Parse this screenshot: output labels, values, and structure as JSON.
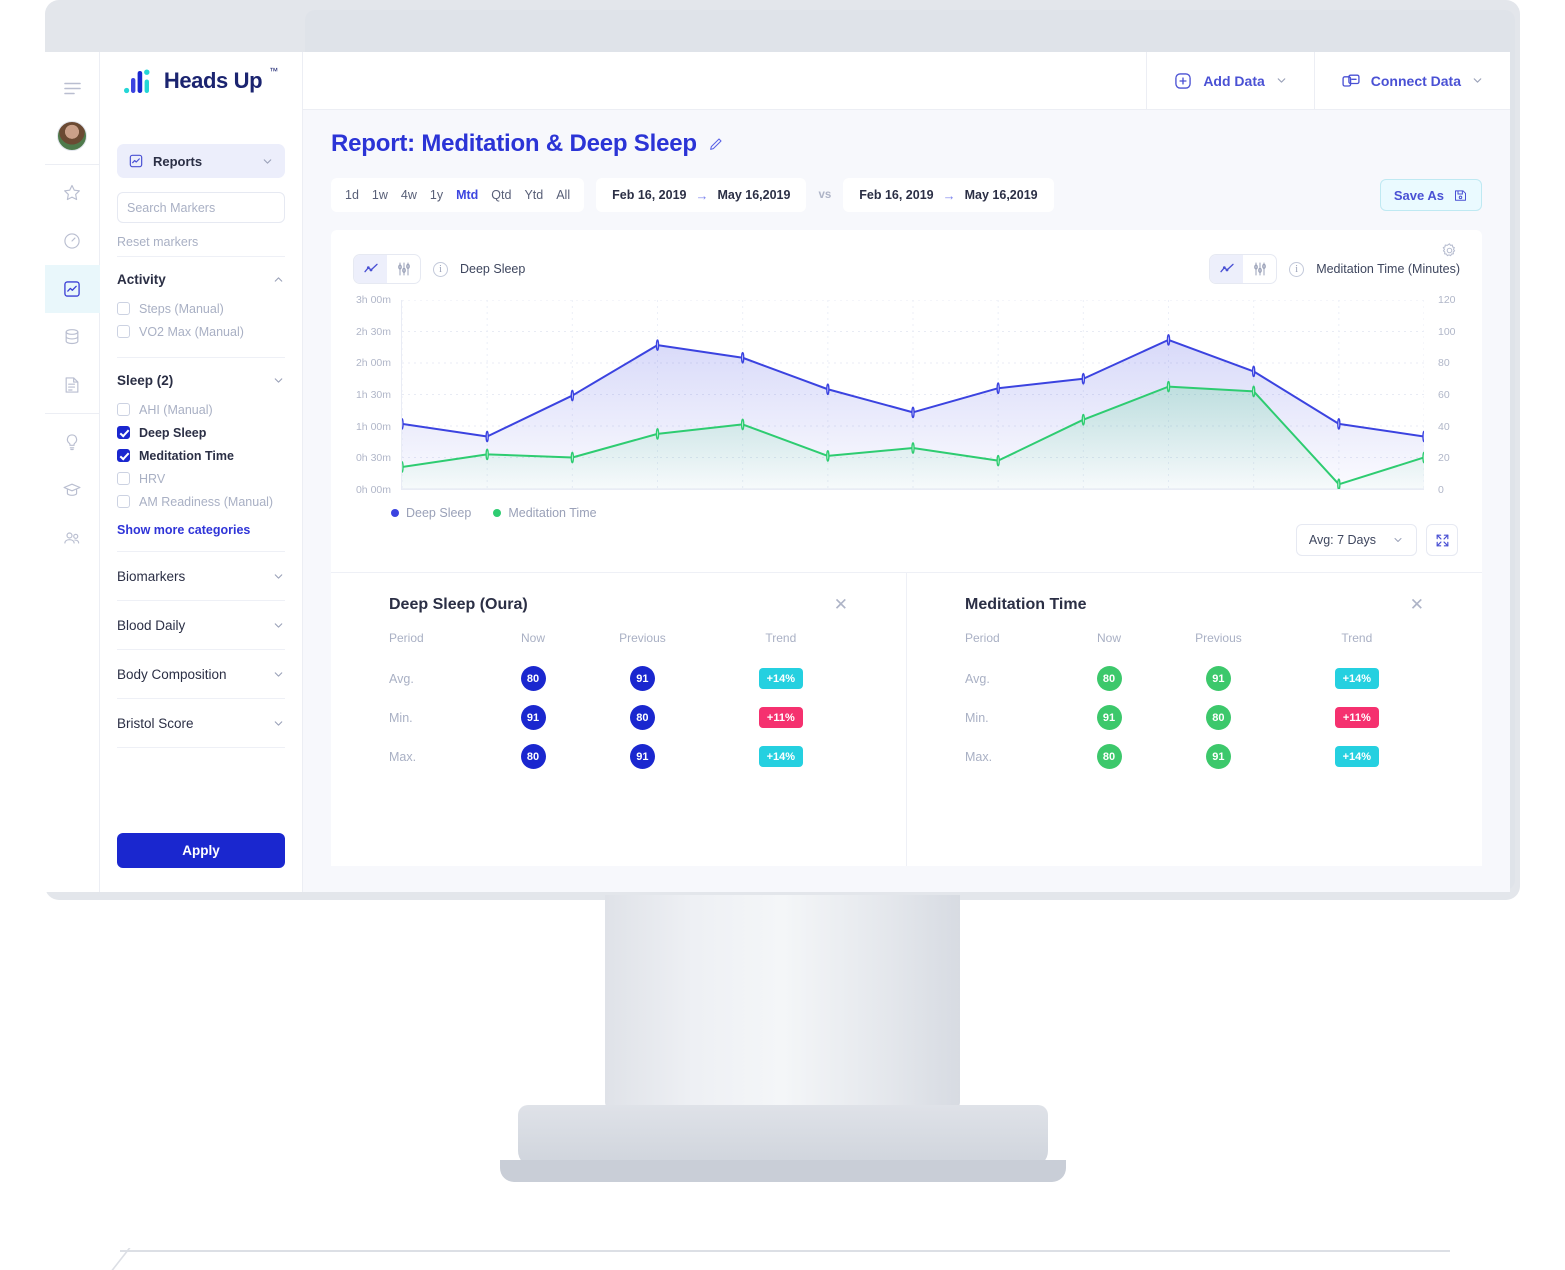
{
  "brand": {
    "name": "Heads Up",
    "tm": "™"
  },
  "rail": {
    "items": [
      {
        "name": "menu-icon",
        "label": "Menu"
      },
      {
        "name": "avatar",
        "label": "User avatar"
      },
      {
        "name": "star-icon",
        "label": "Favorites"
      },
      {
        "name": "gauge-icon",
        "label": "Dashboard"
      },
      {
        "name": "chart-icon",
        "label": "Reports"
      },
      {
        "name": "database-icon",
        "label": "Data"
      },
      {
        "name": "document-icon",
        "label": "Notes"
      },
      {
        "name": "lightbulb-icon",
        "label": "Insights"
      },
      {
        "name": "graduation-cap-icon",
        "label": "Learn"
      },
      {
        "name": "people-icon",
        "label": "Community"
      }
    ]
  },
  "sidebar": {
    "reports_label": "Reports",
    "search_placeholder": "Search Markers",
    "search_value": "",
    "reset_label": "Reset markers",
    "show_more_label": "Show more categories",
    "apply_label": "Apply",
    "groups": [
      {
        "title": "Activity",
        "expanded": true,
        "markers": [
          {
            "label": "Steps (Manual)",
            "checked": false
          },
          {
            "label": "VO2 Max (Manual)",
            "checked": false
          }
        ]
      },
      {
        "title": "Sleep (2)",
        "expanded": true,
        "markers": [
          {
            "label": "AHI (Manual)",
            "checked": false
          },
          {
            "label": "Deep Sleep",
            "checked": true
          },
          {
            "label": "Meditation Time",
            "checked": true
          },
          {
            "label": "HRV",
            "checked": false
          },
          {
            "label": "AM Readiness (Manual)",
            "checked": false
          }
        ]
      }
    ],
    "collapsed_categories": [
      {
        "title": "Biomarkers"
      },
      {
        "title": "Blood Daily"
      },
      {
        "title": "Body Composition"
      },
      {
        "title": "Bristol Score"
      }
    ]
  },
  "topbar": {
    "add_data_label": "Add Data",
    "connect_data_label": "Connect Data"
  },
  "page": {
    "title": "Report: Meditation & Deep Sleep",
    "edit_icon": "pencil-icon",
    "ranges": [
      {
        "label": "1d",
        "active": false
      },
      {
        "label": "1w",
        "active": false
      },
      {
        "label": "4w",
        "active": false
      },
      {
        "label": "1y",
        "active": false
      },
      {
        "label": "Mtd",
        "active": true
      },
      {
        "label": "Qtd",
        "active": false
      },
      {
        "label": "Ytd",
        "active": false
      },
      {
        "label": "All",
        "active": false
      }
    ],
    "date_primary": {
      "from": "Feb 16, 2019",
      "to": "May 16,2019"
    },
    "vs_label": "vs",
    "date_compare": {
      "from": "Feb 16, 2019",
      "to": "May 16,2019"
    },
    "save_as_label": "Save As",
    "avg_select_label": "Avg: 7 Days"
  },
  "chart_header": {
    "left_series": "Deep Sleep",
    "right_series": "Meditation Time (Minutes)"
  },
  "chart_data": {
    "type": "line",
    "title": "",
    "xlabel": "",
    "grid": true,
    "legend_position": "bottom-left",
    "x": [
      1,
      2,
      3,
      4,
      5,
      6,
      7,
      8,
      9,
      10,
      11,
      12,
      13
    ],
    "y_left": {
      "label": "Deep Sleep",
      "ticks": [
        "0h 00m",
        "0h 30m",
        "1h 00m",
        "1h 30m",
        "2h 00m",
        "2h 30m",
        "3h 00m"
      ],
      "ylim": [
        0,
        180
      ],
      "unit": "minutes"
    },
    "y_right": {
      "label": "Meditation Time (Minutes)",
      "ticks": [
        "0",
        "20",
        "40",
        "60",
        "80",
        "100",
        "120"
      ],
      "ylim": [
        0,
        120
      ],
      "unit": "minutes"
    },
    "series": [
      {
        "name": "Deep Sleep",
        "color": "#3b43e0",
        "axis": "left",
        "values": [
          62,
          50,
          89,
          137,
          125,
          95,
          73,
          96,
          105,
          142,
          112,
          62,
          50
        ]
      },
      {
        "name": "Meditation Time",
        "color": "#2ecc71",
        "axis": "right",
        "values": [
          14,
          22,
          20,
          35,
          41,
          21,
          26,
          18,
          44,
          65,
          62,
          3,
          20
        ]
      }
    ],
    "legend": [
      {
        "label": "Deep Sleep",
        "color": "#3b43e0"
      },
      {
        "label": "Meditation Time",
        "color": "#2ecc71"
      }
    ]
  },
  "tables": [
    {
      "title": "Deep Sleep (Oura)",
      "accent": "#1a27cf",
      "columns": [
        "Period",
        "Now",
        "Previous",
        "Trend"
      ],
      "rows": [
        {
          "period": "Avg.",
          "now": "80",
          "previous": "91",
          "trend": "+14%",
          "trend_color": "#25d0e0"
        },
        {
          "period": "Min.",
          "now": "91",
          "previous": "80",
          "trend": "+11%",
          "trend_color": "#f5316f"
        },
        {
          "period": "Max.",
          "now": "80",
          "previous": "91",
          "trend": "+14%",
          "trend_color": "#25d0e0"
        }
      ]
    },
    {
      "title": "Meditation Time",
      "accent": "#3cc86b",
      "columns": [
        "Period",
        "Now",
        "Previous",
        "Trend"
      ],
      "rows": [
        {
          "period": "Avg.",
          "now": "80",
          "previous": "91",
          "trend": "+14%",
          "trend_color": "#25d0e0"
        },
        {
          "period": "Min.",
          "now": "91",
          "previous": "80",
          "trend": "+11%",
          "trend_color": "#f5316f"
        },
        {
          "period": "Max.",
          "now": "80",
          "previous": "91",
          "trend": "+14%",
          "trend_color": "#25d0e0"
        }
      ]
    }
  ],
  "colors": {
    "brand_blue": "#1a27cf",
    "accent_indigo": "#4a51d4",
    "deep_sleep": "#3b43e0",
    "meditation": "#2ecc71",
    "trend_up": "#25d0e0",
    "trend_down": "#f5316f"
  }
}
